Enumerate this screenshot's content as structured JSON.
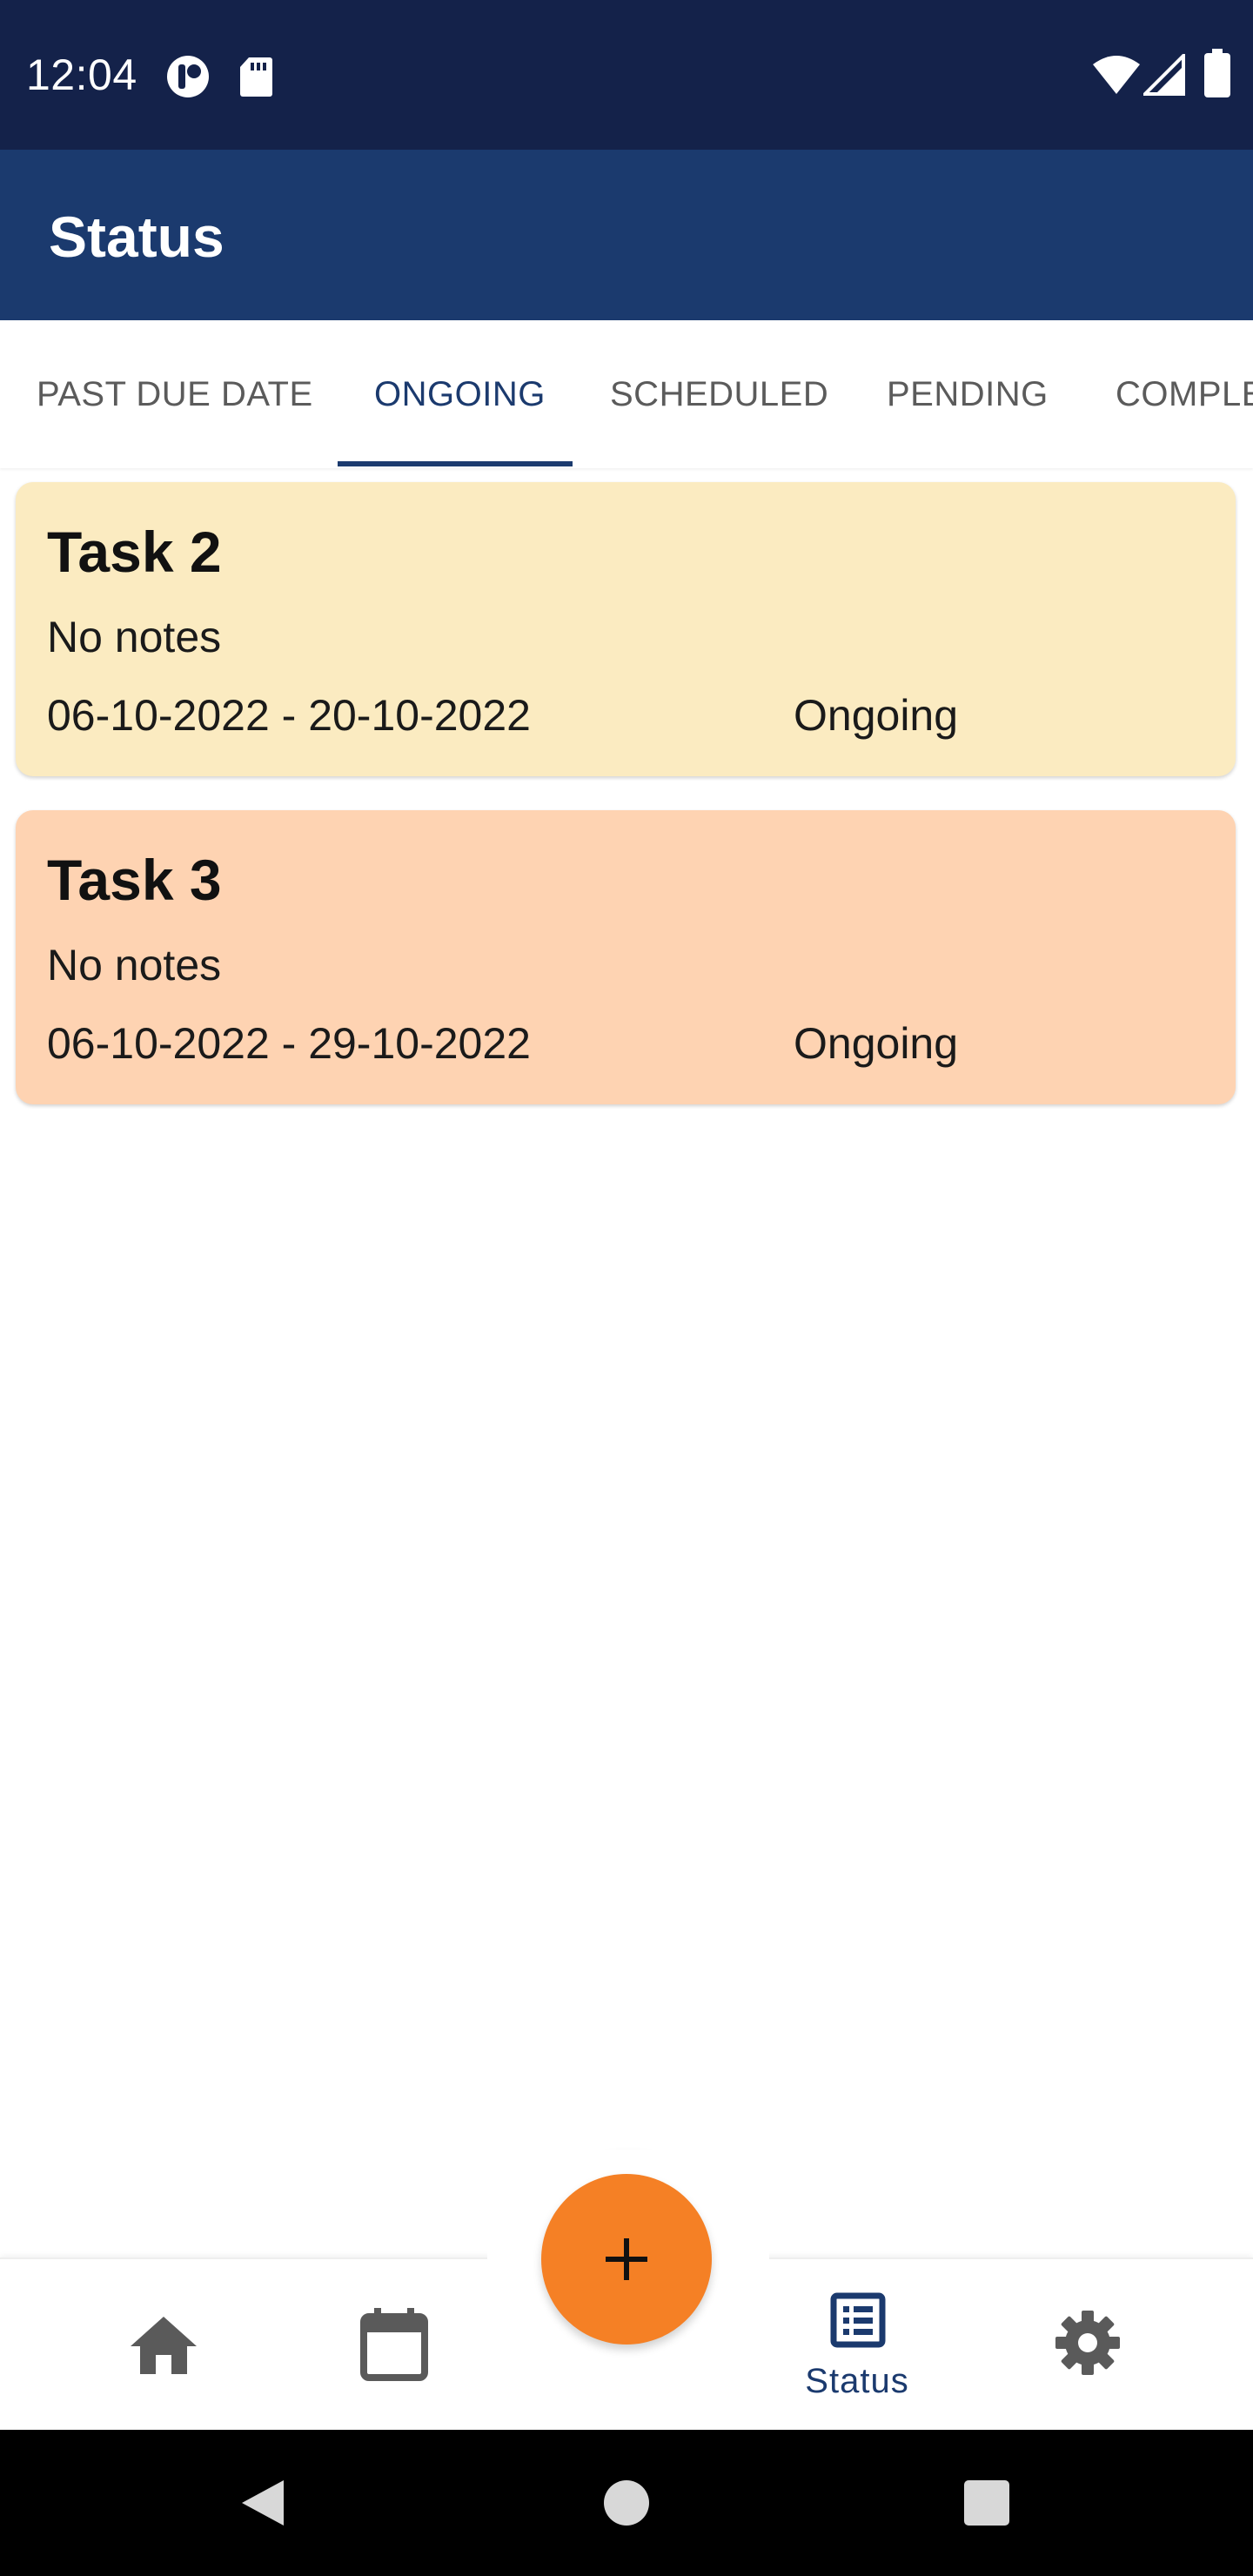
{
  "status_bar": {
    "time": "12:04",
    "icons": [
      "app-notification-icon",
      "sd-card-icon",
      "wifi-icon",
      "cell-signal-icon",
      "battery-icon"
    ]
  },
  "app_bar": {
    "title": "Status"
  },
  "tabs": [
    {
      "label": "PAST DUE DATE",
      "active": false
    },
    {
      "label": "ONGOING",
      "active": true
    },
    {
      "label": "SCHEDULED",
      "active": false
    },
    {
      "label": "PENDING",
      "active": false
    },
    {
      "label": "COMPLE",
      "active": false
    }
  ],
  "tasks": [
    {
      "title": "Task 2",
      "notes": "No notes",
      "dates": "06-10-2022 - 20-10-2022",
      "status": "Ongoing",
      "color": "#fbebc1"
    },
    {
      "title": "Task 3",
      "notes": "No notes",
      "dates": "06-10-2022 - 29-10-2022",
      "status": "Ongoing",
      "color": "#fed3b2"
    }
  ],
  "fab": {
    "icon": "plus-icon",
    "color": "#f58025"
  },
  "bottom_nav": {
    "items": [
      {
        "icon": "home-icon",
        "label": ""
      },
      {
        "icon": "calendar-icon",
        "label": ""
      },
      {
        "icon": "list-icon",
        "label": "Status",
        "active": true
      },
      {
        "icon": "gear-icon",
        "label": ""
      }
    ]
  },
  "colors": {
    "status_bar": "#14224a",
    "primary": "#1b3a6e",
    "accent": "#f58025"
  }
}
